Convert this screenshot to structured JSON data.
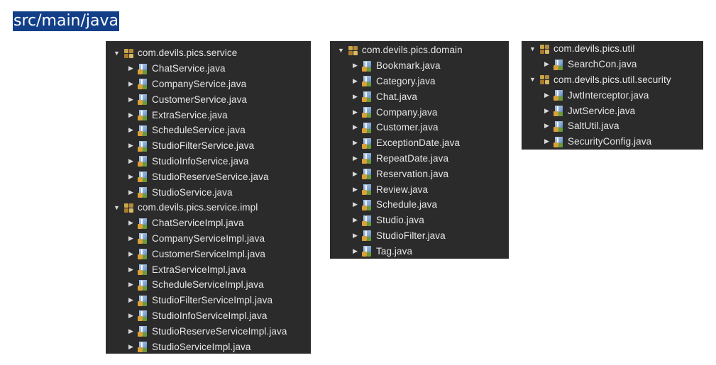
{
  "title": "src/main/java",
  "panels": {
    "service": {
      "rows": [
        {
          "type": "package",
          "label": "com.devils.pics.service",
          "expanded": true,
          "depth": 0
        },
        {
          "type": "java",
          "label": "ChatService.java",
          "depth": 1
        },
        {
          "type": "java",
          "label": "CompanyService.java",
          "depth": 1
        },
        {
          "type": "java",
          "label": "CustomerService.java",
          "depth": 1
        },
        {
          "type": "java",
          "label": "ExtraService.java",
          "depth": 1
        },
        {
          "type": "java",
          "label": "ScheduleService.java",
          "depth": 1
        },
        {
          "type": "java",
          "label": "StudioFilterService.java",
          "depth": 1
        },
        {
          "type": "java",
          "label": "StudioInfoService.java",
          "depth": 1
        },
        {
          "type": "java",
          "label": "StudioReserveService.java",
          "depth": 1
        },
        {
          "type": "java",
          "label": "StudioService.java",
          "depth": 1
        },
        {
          "type": "package",
          "label": "com.devils.pics.service.impl",
          "expanded": true,
          "depth": 0
        },
        {
          "type": "java",
          "label": "ChatServiceImpl.java",
          "depth": 1
        },
        {
          "type": "java",
          "label": "CompanyServiceImpl.java",
          "depth": 1
        },
        {
          "type": "java",
          "label": "CustomerServiceImpl.java",
          "depth": 1
        },
        {
          "type": "java",
          "label": "ExtraServiceImpl.java",
          "depth": 1
        },
        {
          "type": "java",
          "label": "ScheduleServiceImpl.java",
          "depth": 1
        },
        {
          "type": "java",
          "label": "StudioFilterServiceImpl.java",
          "depth": 1
        },
        {
          "type": "java",
          "label": "StudioInfoServiceImpl.java",
          "depth": 1
        },
        {
          "type": "java",
          "label": "StudioReserveServiceImpl.java",
          "depth": 1
        },
        {
          "type": "java",
          "label": "StudioServiceImpl.java",
          "depth": 1
        }
      ]
    },
    "domain": {
      "rows": [
        {
          "type": "package",
          "label": "com.devils.pics.domain",
          "expanded": true,
          "depth": 0
        },
        {
          "type": "java",
          "label": "Bookmark.java",
          "depth": 1
        },
        {
          "type": "java",
          "label": "Category.java",
          "depth": 1
        },
        {
          "type": "java",
          "label": "Chat.java",
          "depth": 1
        },
        {
          "type": "java",
          "label": "Company.java",
          "depth": 1
        },
        {
          "type": "java",
          "label": "Customer.java",
          "depth": 1
        },
        {
          "type": "java",
          "label": "ExceptionDate.java",
          "depth": 1
        },
        {
          "type": "java",
          "label": "RepeatDate.java",
          "depth": 1
        },
        {
          "type": "java",
          "label": "Reservation.java",
          "depth": 1
        },
        {
          "type": "java",
          "label": "Review.java",
          "depth": 1
        },
        {
          "type": "java",
          "label": "Schedule.java",
          "depth": 1
        },
        {
          "type": "java",
          "label": "Studio.java",
          "depth": 1
        },
        {
          "type": "java",
          "label": "StudioFilter.java",
          "depth": 1
        },
        {
          "type": "java",
          "label": "Tag.java",
          "depth": 1
        }
      ]
    },
    "util": {
      "rows": [
        {
          "type": "package",
          "label": "com.devils.pics.util",
          "expanded": true,
          "depth": 0
        },
        {
          "type": "java",
          "label": "SearchCon.java",
          "depth": 1
        },
        {
          "type": "package",
          "label": "com.devils.pics.util.security",
          "expanded": true,
          "depth": 0
        },
        {
          "type": "java",
          "label": "JwtInterceptor.java",
          "depth": 1
        },
        {
          "type": "java",
          "label": "JwtService.java",
          "depth": 1
        },
        {
          "type": "java",
          "label": "SaltUtil.java",
          "depth": 1
        },
        {
          "type": "java",
          "label": "SecurityConfig.java",
          "depth": 1
        }
      ]
    }
  },
  "icons": {
    "collapsed_arrow": "▶",
    "expanded_arrow": "▼",
    "package_icon": "package-icon",
    "java_icon": "java-file-icon"
  },
  "colors": {
    "title_bg": "#123f88",
    "title_text": "#ffffff",
    "panel_bg": "#2b2b2b",
    "row_text": "#e6e6e6"
  }
}
